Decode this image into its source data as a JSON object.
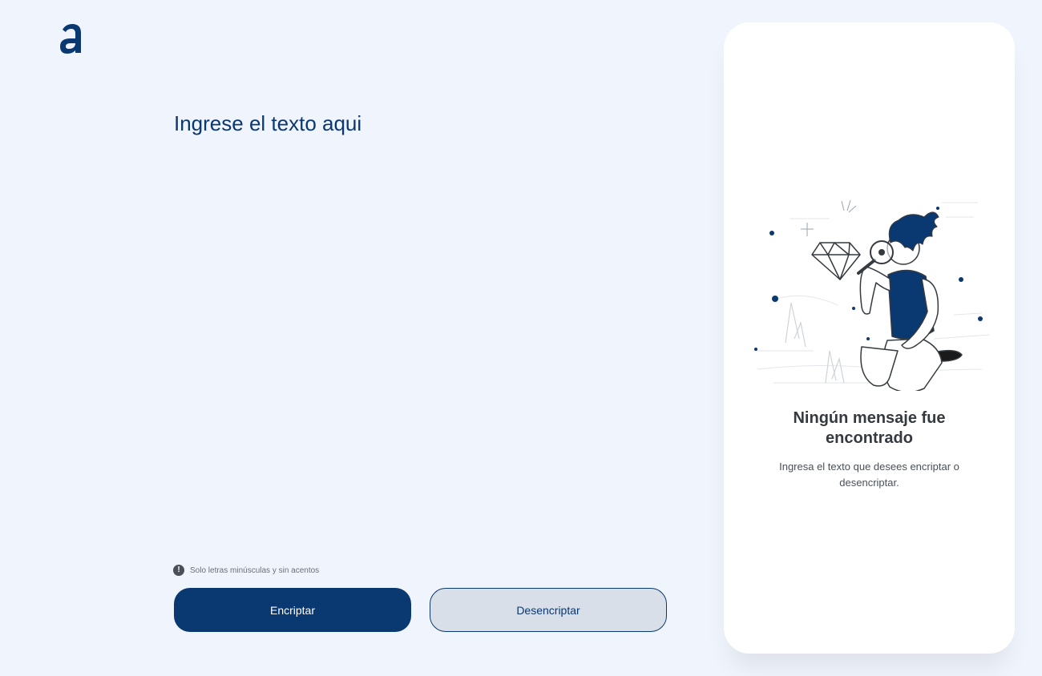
{
  "app": {
    "logo_icon": "alura-a-logo-icon",
    "accent_color": "#0a3871"
  },
  "editor": {
    "placeholder": "Ingrese el texto aqui",
    "value": ""
  },
  "hint": {
    "icon": "info-icon",
    "icon_glyph": "!",
    "text": "Solo letras minúsculas y sin acentos"
  },
  "actions": {
    "encrypt_label": "Encriptar",
    "decrypt_label": "Desencriptar"
  },
  "output_panel": {
    "illustration": "person-with-magnifying-glass-looking-at-diamond-illustration",
    "title_line1": "Ningún mensaje fue",
    "title_line2": "encontrado",
    "message": "Ingresa el texto que desees encriptar o desencriptar."
  }
}
